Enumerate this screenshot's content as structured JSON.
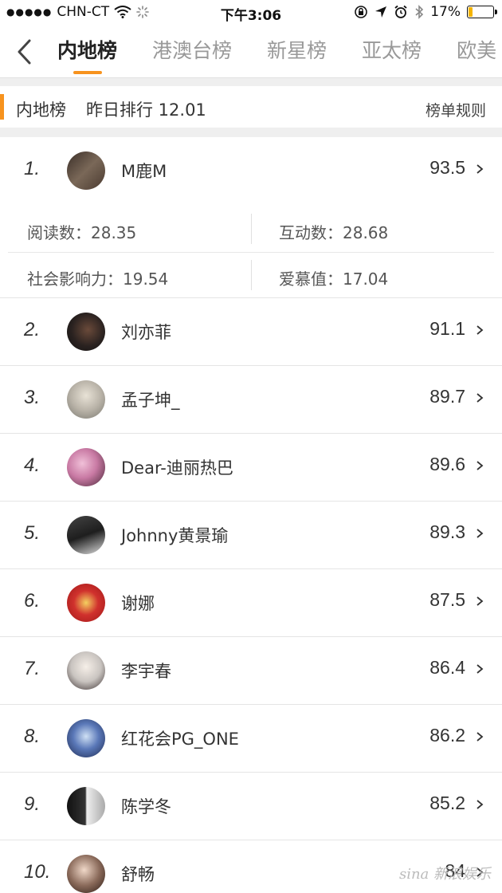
{
  "status_bar": {
    "carrier": "CHN-CT",
    "signal_dots": "●●●●●",
    "time": "下午3:06",
    "battery_percent": "17%",
    "battery_level": 0.17,
    "battery_color": "#f5b400"
  },
  "nav": {
    "back_icon": "chevron-left-icon",
    "tabs": [
      {
        "label": "内地榜",
        "active": true
      },
      {
        "label": "港澳台榜",
        "active": false
      },
      {
        "label": "新星榜",
        "active": false
      },
      {
        "label": "亚太榜",
        "active": false
      },
      {
        "label": "欧美",
        "active": false
      }
    ],
    "accent_color": "#f7931e"
  },
  "section": {
    "title": "内地榜",
    "subtitle": "昨日排行 12.01",
    "rules_label": "榜单规则"
  },
  "stats": {
    "reads": "阅读数：28.35",
    "interactions": "互动数：28.68",
    "influence": "社会影响力：19.54",
    "love": "爱慕值：17.04"
  },
  "rankings": [
    {
      "rank": "1.",
      "name": "M鹿M",
      "score": "93.5",
      "avatar_color": "#6b5a4e"
    },
    {
      "rank": "2.",
      "name": "刘亦菲",
      "score": "91.1",
      "avatar_color": "#2a2220"
    },
    {
      "rank": "3.",
      "name": "孟子坤_",
      "score": "89.7",
      "avatar_color": "#b9b3a8"
    },
    {
      "rank": "4.",
      "name": "Dear-迪丽热巴",
      "score": "89.6",
      "avatar_color": "#c97aa4"
    },
    {
      "rank": "5.",
      "name": "Johnny黄景瑜",
      "score": "89.3",
      "avatar_color": "#1e1e1e"
    },
    {
      "rank": "6.",
      "name": "谢娜",
      "score": "87.5",
      "avatar_color": "#d0312d"
    },
    {
      "rank": "7.",
      "name": "李宇春",
      "score": "86.4",
      "avatar_color": "#c9c4c0"
    },
    {
      "rank": "8.",
      "name": "红花会PG_ONE",
      "score": "86.2",
      "avatar_color": "#5a78b8"
    },
    {
      "rank": "9.",
      "name": "陈学冬",
      "score": "85.2",
      "avatar_color": "#555555"
    },
    {
      "rank": "10.",
      "name": "舒畅",
      "score": "84",
      "avatar_color": "#8a6a5a"
    }
  ],
  "watermark": "sina 新浪娱乐"
}
